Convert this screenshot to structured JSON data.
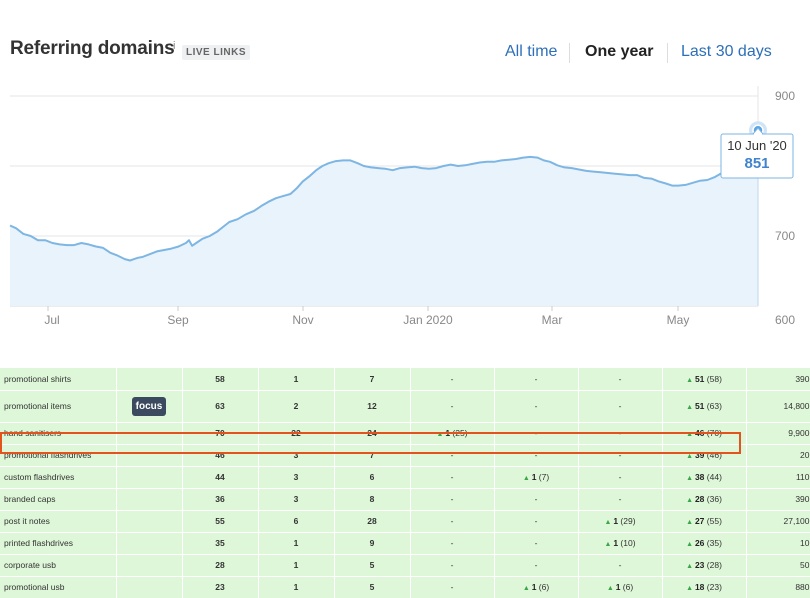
{
  "header": {
    "title": "Referring domains",
    "info_mark": "i",
    "badge": "LIVE LINKS",
    "ranges": [
      {
        "label": "All time",
        "active": false
      },
      {
        "label": "One year",
        "active": true
      },
      {
        "label": "Last 30 days",
        "active": false
      }
    ]
  },
  "chart_data": {
    "type": "area",
    "x_ticks": [
      "Jul",
      "Sep",
      "Nov",
      "Jan 2020",
      "Mar",
      "May"
    ],
    "y_ticks": [
      900,
      700,
      600
    ],
    "ylim": [
      600,
      900
    ],
    "grid": true,
    "series": [
      {
        "values": [
          [
            0.0,
            715
          ],
          [
            0.6,
            711
          ],
          [
            1.3,
            703
          ],
          [
            2.0,
            700
          ],
          [
            2.7,
            694
          ],
          [
            3.4,
            694
          ],
          [
            4.1,
            690
          ],
          [
            4.8,
            688
          ],
          [
            5.5,
            687
          ],
          [
            6.2,
            687
          ],
          [
            6.9,
            690
          ],
          [
            7.6,
            688
          ],
          [
            8.3,
            685
          ],
          [
            9.0,
            683
          ],
          [
            9.7,
            676
          ],
          [
            10.4,
            672
          ],
          [
            11.1,
            667
          ],
          [
            11.6,
            665
          ],
          [
            12.0,
            667
          ],
          [
            12.4,
            669
          ],
          [
            12.8,
            670
          ],
          [
            13.5,
            674
          ],
          [
            14.2,
            678
          ],
          [
            14.9,
            680
          ],
          [
            15.6,
            682
          ],
          [
            16.3,
            685
          ],
          [
            17.0,
            690
          ],
          [
            17.3,
            694
          ],
          [
            17.6,
            686
          ],
          [
            18.0,
            690
          ],
          [
            18.6,
            696
          ],
          [
            19.3,
            700
          ],
          [
            20.0,
            706
          ],
          [
            20.6,
            713
          ],
          [
            21.2,
            720
          ],
          [
            22.0,
            724
          ],
          [
            22.8,
            731
          ],
          [
            23.6,
            736
          ],
          [
            24.3,
            743
          ],
          [
            25.0,
            749
          ],
          [
            25.7,
            754
          ],
          [
            26.4,
            757
          ],
          [
            27.1,
            760
          ],
          [
            27.7,
            768
          ],
          [
            28.3,
            778
          ],
          [
            29.0,
            786
          ],
          [
            29.6,
            794
          ],
          [
            30.2,
            800
          ],
          [
            30.8,
            804
          ],
          [
            31.5,
            807
          ],
          [
            32.2,
            808
          ],
          [
            32.9,
            808
          ],
          [
            33.6,
            804
          ],
          [
            34.2,
            800
          ],
          [
            34.9,
            798
          ],
          [
            35.6,
            797
          ],
          [
            36.3,
            796
          ],
          [
            37.0,
            794
          ],
          [
            37.7,
            797
          ],
          [
            38.4,
            798
          ],
          [
            39.1,
            799
          ],
          [
            39.8,
            797
          ],
          [
            40.5,
            796
          ],
          [
            41.2,
            797
          ],
          [
            41.9,
            800
          ],
          [
            42.6,
            802
          ],
          [
            43.3,
            800
          ],
          [
            44.0,
            801
          ],
          [
            44.7,
            803
          ],
          [
            45.4,
            805
          ],
          [
            46.1,
            806
          ],
          [
            46.8,
            806
          ],
          [
            47.5,
            808
          ],
          [
            48.2,
            809
          ],
          [
            48.9,
            810
          ],
          [
            49.6,
            812
          ],
          [
            50.3,
            813
          ],
          [
            51.0,
            812
          ],
          [
            51.6,
            808
          ],
          [
            52.2,
            806
          ],
          [
            52.9,
            801
          ],
          [
            53.6,
            798
          ],
          [
            54.3,
            797
          ],
          [
            55.0,
            795
          ],
          [
            55.7,
            793
          ],
          [
            56.4,
            792
          ],
          [
            57.1,
            791
          ],
          [
            57.8,
            790
          ],
          [
            58.5,
            789
          ],
          [
            59.2,
            788
          ],
          [
            59.9,
            787
          ],
          [
            60.6,
            787
          ],
          [
            61.3,
            783
          ],
          [
            62.0,
            782
          ],
          [
            62.7,
            778
          ],
          [
            63.4,
            775
          ],
          [
            64.0,
            772
          ],
          [
            64.6,
            772
          ],
          [
            65.3,
            773
          ],
          [
            66.0,
            776
          ],
          [
            66.7,
            779
          ],
          [
            67.4,
            780
          ],
          [
            68.1,
            784
          ],
          [
            68.8,
            790
          ],
          [
            69.5,
            800
          ],
          [
            70.2,
            812
          ],
          [
            70.9,
            826
          ],
          [
            71.6,
            842
          ],
          [
            72.3,
            851
          ]
        ]
      }
    ],
    "tooltip": {
      "date": "10 Jun '20",
      "value": "851"
    }
  },
  "table": {
    "rows": [
      {
        "keyword": "promotional shirts",
        "focus": "",
        "c1": "58",
        "c2": "1",
        "c3": "7",
        "c4": "-",
        "c5": "-",
        "c6": "-",
        "c7_up": "51",
        "c7_paren": "(58)",
        "vol": "390"
      },
      {
        "keyword": "promotional items",
        "focus": "focus",
        "c1": "63",
        "c2": "2",
        "c3": "12",
        "c4": "-",
        "c5": "-",
        "c6": "-",
        "c7_up": "51",
        "c7_paren": "(63)",
        "vol": "14,800"
      },
      {
        "keyword": "hand sanitisers",
        "focus": "",
        "c1": "70",
        "c2": "22",
        "c3": "24",
        "c4_up": "1",
        "c4_paren": "(25)",
        "c5": "-",
        "c6": "-",
        "c7_up": "46",
        "c7_paren": "(70)",
        "vol": "9,900"
      },
      {
        "keyword": "promotional flashdrives",
        "focus": "",
        "c1": "46",
        "c2": "3",
        "c3": "7",
        "c4": "-",
        "c5": "-",
        "c6": "-",
        "c7_up": "39",
        "c7_paren": "(46)",
        "vol": "20"
      },
      {
        "keyword": "custom flashdrives",
        "focus": "",
        "c1": "44",
        "c2": "3",
        "c3": "6",
        "c4": "-",
        "c5_up": "1",
        "c5_paren": "(7)",
        "c6": "-",
        "c7_up": "38",
        "c7_paren": "(44)",
        "vol": "110"
      },
      {
        "keyword": "branded caps",
        "focus": "",
        "c1": "36",
        "c2": "3",
        "c3": "8",
        "c4": "-",
        "c5": "-",
        "c6": "-",
        "c7_up": "28",
        "c7_paren": "(36)",
        "vol": "390"
      },
      {
        "keyword": "post it notes",
        "focus": "",
        "c1": "55",
        "c2": "6",
        "c3": "28",
        "c4": "-",
        "c5": "-",
        "c6_up": "1",
        "c6_paren": "(29)",
        "c7_up": "27",
        "c7_paren": "(55)",
        "vol": "27,100"
      },
      {
        "keyword": "printed flashdrives",
        "focus": "",
        "c1": "35",
        "c2": "1",
        "c3": "9",
        "c4": "-",
        "c5": "-",
        "c6_up": "1",
        "c6_paren": "(10)",
        "c7_up": "26",
        "c7_paren": "(35)",
        "vol": "10"
      },
      {
        "keyword": "corporate usb",
        "focus": "",
        "c1": "28",
        "c2": "1",
        "c3": "5",
        "c4": "-",
        "c5": "-",
        "c6": "-",
        "c7_up": "23",
        "c7_paren": "(28)",
        "vol": "50"
      },
      {
        "keyword": "promotional usb",
        "focus": "",
        "c1": "23",
        "c2": "1",
        "c3": "5",
        "c4": "-",
        "c5_up": "1",
        "c5_paren": "(6)",
        "c6_up": "1",
        "c6_paren": "(6)",
        "c7_up": "18",
        "c7_paren": "(23)",
        "vol": "880"
      }
    ]
  }
}
